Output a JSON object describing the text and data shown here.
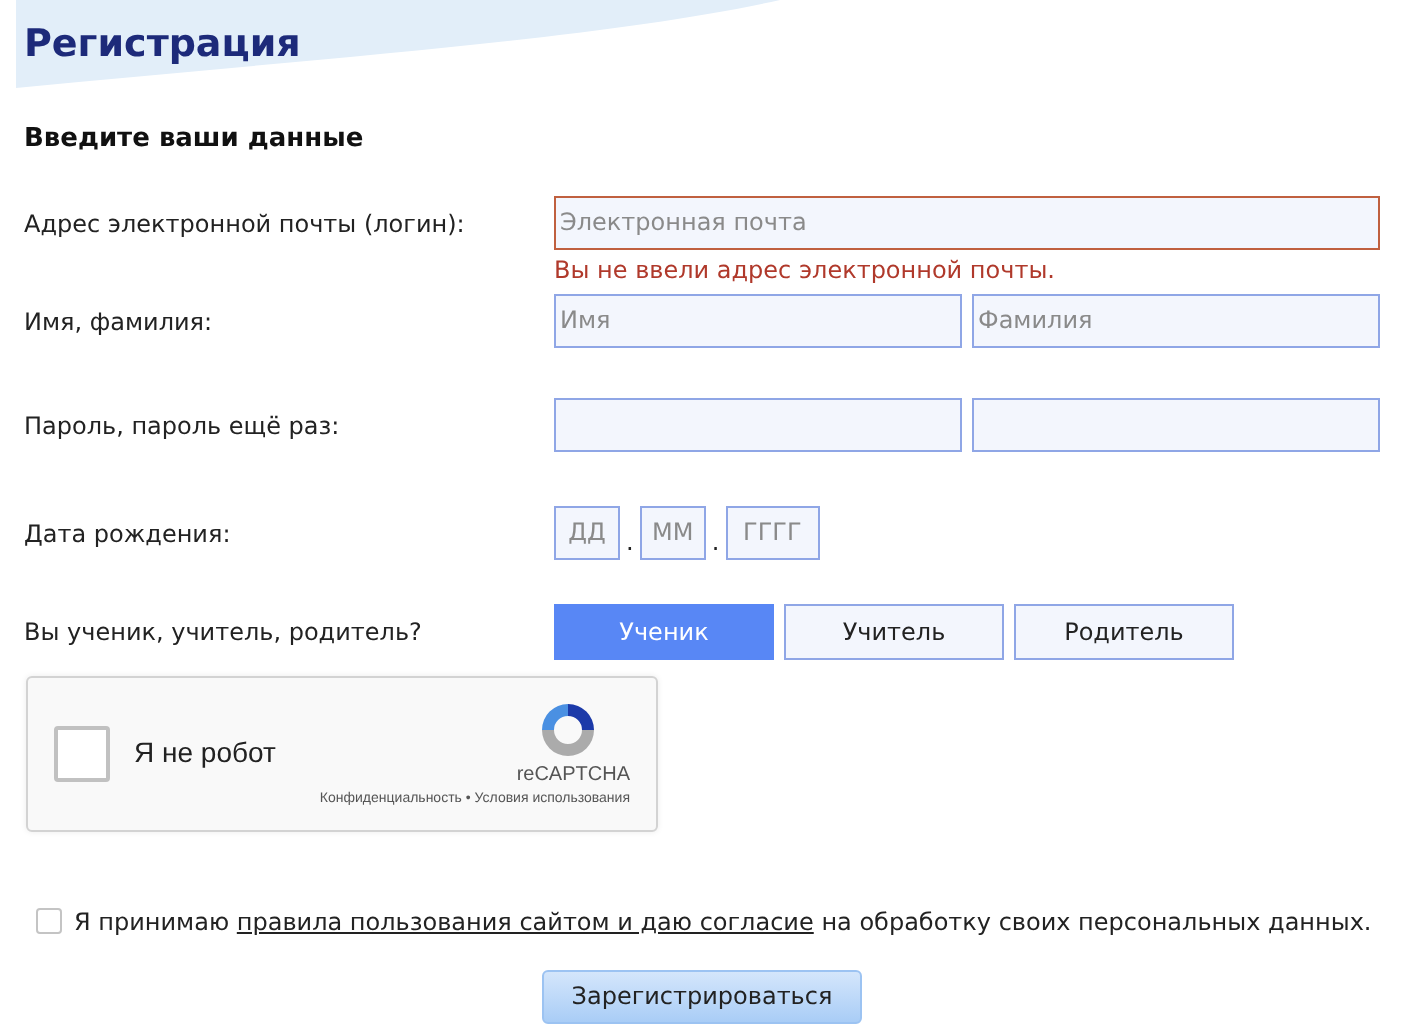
{
  "title": "Регистрация",
  "subtitle": "Введите ваши данные",
  "email": {
    "label": "Адрес электронной почты (логин):",
    "placeholder": "Электронная почта",
    "invalid": true,
    "error": "Вы не ввели адрес электронной почты."
  },
  "name": {
    "label": "Имя, фамилия:",
    "fields": [
      {
        "placeholder": "Имя"
      },
      {
        "placeholder": "Фамилия"
      }
    ]
  },
  "password": {
    "label": "Пароль, пароль ещё раз:"
  },
  "birth_date": {
    "label": "Дата рождения:",
    "parts": [
      {
        "placeholder": "ДД"
      },
      {
        "placeholder": "ММ"
      },
      {
        "placeholder": "ГГГГ"
      }
    ],
    "separators": [
      ".",
      "."
    ]
  },
  "role": {
    "label": "Вы ученик, учитель, родитель?",
    "options": [
      {
        "label": "Ученик",
        "selected": true
      },
      {
        "label": "Учитель",
        "selected": false
      },
      {
        "label": "Родитель",
        "selected": false
      }
    ]
  },
  "captcha": {
    "label": "Я не робот",
    "checked": false,
    "brand": "reCAPTCHA",
    "privacy": "Конфиденциальность",
    "separator": "•",
    "terms": "Условия использования"
  },
  "agreement": {
    "checked": false,
    "before": "Я принимаю",
    "link": "правила пользования сайтом и даю согласие",
    "after": "на обработку своих персональных данных."
  },
  "submit": "Зарегистрироваться"
}
